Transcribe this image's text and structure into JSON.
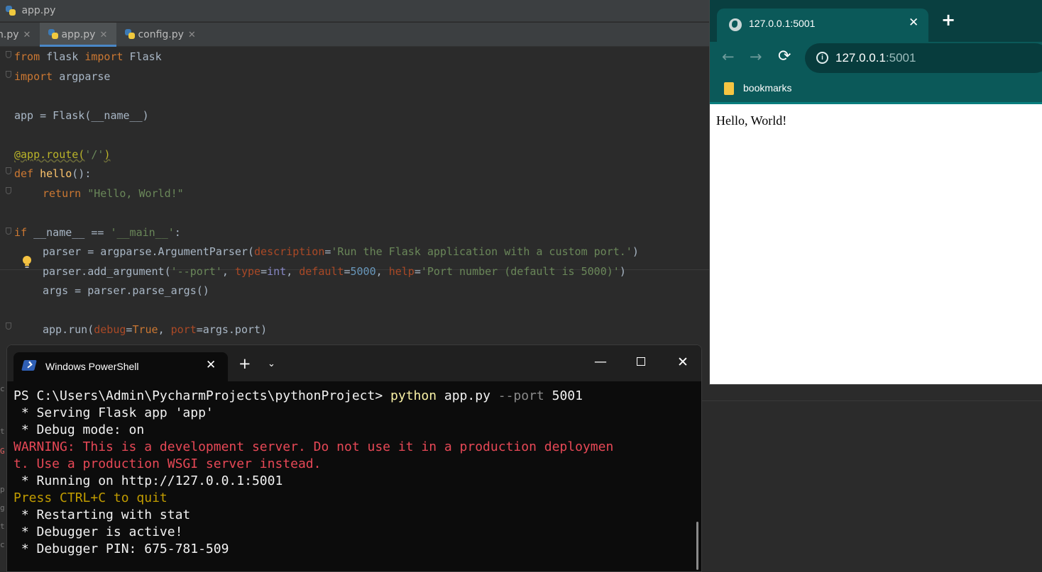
{
  "ide": {
    "window_title": "app.py",
    "tabs": [
      {
        "label": "n.py",
        "close": "✕"
      },
      {
        "label": "app.py",
        "close": "✕"
      },
      {
        "label": "config.py",
        "close": "✕"
      }
    ],
    "code": {
      "l1": {
        "kw": "from",
        "a": " flask ",
        "kw2": "import",
        "b": " Flask"
      },
      "l2": {
        "kw": "import",
        "a": " argparse"
      },
      "l3": "app = Flask(__name__)",
      "l4": {
        "deco": "@app.route(",
        "str": "'/'",
        "end": ")"
      },
      "l5": {
        "kw": "def",
        "sp": " ",
        "fn": "hello",
        "rest": "():"
      },
      "l6": {
        "kw": "return",
        "sp": " ",
        "str": "\"Hello, World!\""
      },
      "l7": {
        "kw": "if",
        "a": " __name__ == ",
        "str": "'__main__'",
        "end": ":"
      },
      "l8": {
        "a": "parser = argparse.ArgumentParser(",
        "p1": "description",
        "eq": "=",
        "s1": "'Run the Flask application with a custom port.'",
        "end": ")"
      },
      "l9": {
        "a": "parser.add_argument(",
        "s1": "'--port'",
        "c1": ", ",
        "p1": "type",
        "eq1": "=",
        "b1": "int",
        "c2": ", ",
        "p2": "default",
        "eq2": "=",
        "n1": "5000",
        "c3": ", ",
        "p3": "help",
        "eq3": "=",
        "s2": "'Port number (default is 5000)'",
        "end": ")"
      },
      "l10": "args = parser.parse_args()",
      "l11": {
        "a": "app.run(",
        "p1": "debug",
        "eq1": "=",
        "k1": "True",
        "c1": ", ",
        "p2": "port",
        "eq2": "=",
        "b": "args.port",
        "end": ")"
      }
    },
    "left_sliver_chars": [
      "c",
      "",
      "t",
      "p",
      "G",
      "p",
      "g",
      "t",
      "c"
    ]
  },
  "browser": {
    "tab_title": "127.0.0.1:5001",
    "tab_close": "✕",
    "new_tab": "+",
    "back": "←",
    "forward": "→",
    "reload": "⟳",
    "info": "i",
    "url_host": "127.0.0.1",
    "url_port": ":5001",
    "bookmarks_label": "bookmarks",
    "page_text": "Hello, World!"
  },
  "powershell": {
    "tab_title": "Windows PowerShell",
    "tab_close": "✕",
    "new_tab": "+",
    "dropdown": "⌄",
    "minimize": "—",
    "close": "✕",
    "prompt": "PS C:\\Users\\Admin\\PycharmProjects\\pythonProject> ",
    "cmd": "python",
    "cmd_arg": " app.py ",
    "cmd_flag": "--port",
    "cmd_val": " 5001",
    "lines": [
      " * Serving Flask app 'app'",
      " * Debug mode: on",
      "WARNING: This is a development server. Do not use it in a production deploymen",
      "t. Use a production WSGI server instead.",
      " * Running on http://127.0.0.1:5001",
      "Press CTRL+C to quit",
      " * Restarting with stat",
      " * Debugger is active!",
      " * Debugger PIN: 675-781-509"
    ]
  }
}
